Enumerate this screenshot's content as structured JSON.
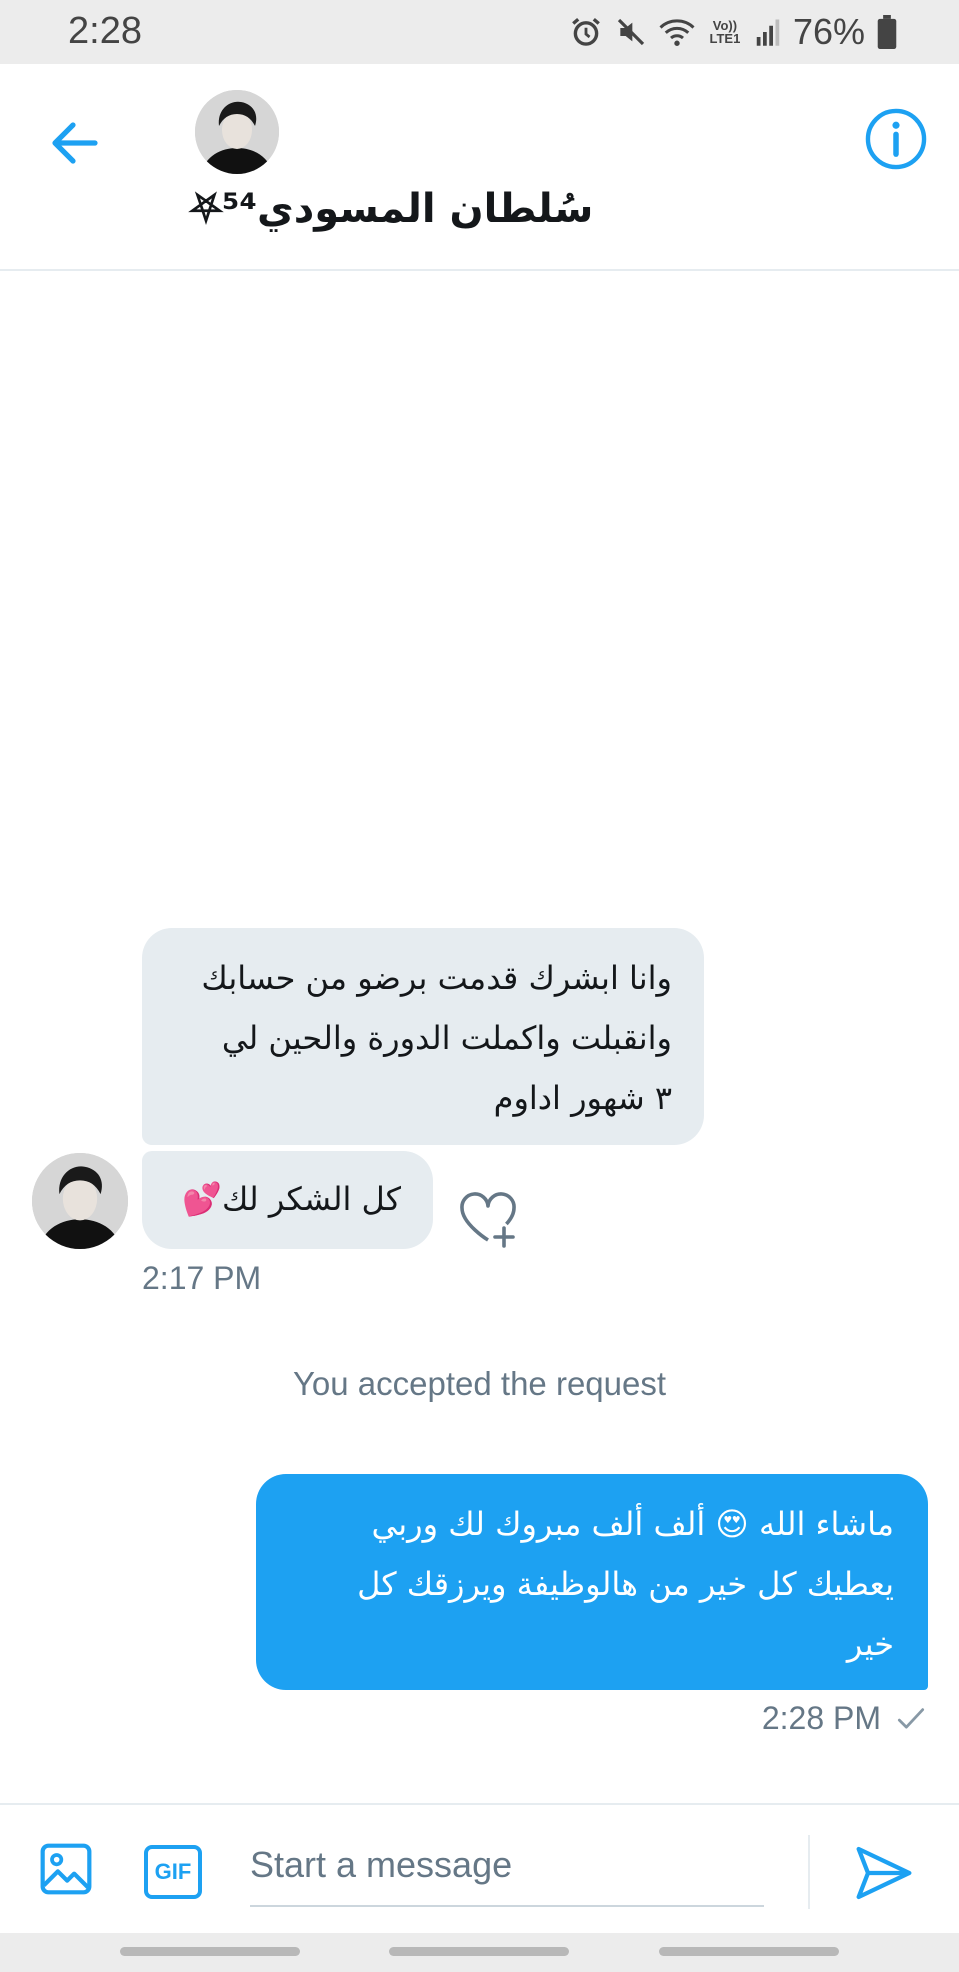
{
  "status_bar": {
    "time": "2:28",
    "battery_percent": "76%",
    "network_label": "Vo)) LTE1"
  },
  "header": {
    "contact_name": "سُلطان المسودي⁵⁴⛧"
  },
  "messages": {
    "received": [
      {
        "lines": [
          "وانا ابشرك قدمت برضو من حسابك",
          "وانقبلت واكملت الدورة والحين لي",
          "٣ شهور اداوم"
        ]
      },
      {
        "text": "كل الشكر لك💕"
      }
    ],
    "received_timestamp": "2:17 PM",
    "system_text": "You accepted the request",
    "sent": {
      "lines": [
        "ماشاء الله 😍 ألف ألف مبروك لك وربي",
        "يعطيك كل خير من هالوظيفة  ويرزقك كل",
        "خير"
      ]
    },
    "sent_timestamp": "2:28 PM",
    "sent_status_icon": "checkmark-icon"
  },
  "compose": {
    "placeholder": "Start a message",
    "gif_label": "GIF"
  },
  "colors": {
    "accent": "#1da1f2",
    "received_bubble": "#e6ecf0",
    "muted_text": "#657786"
  }
}
